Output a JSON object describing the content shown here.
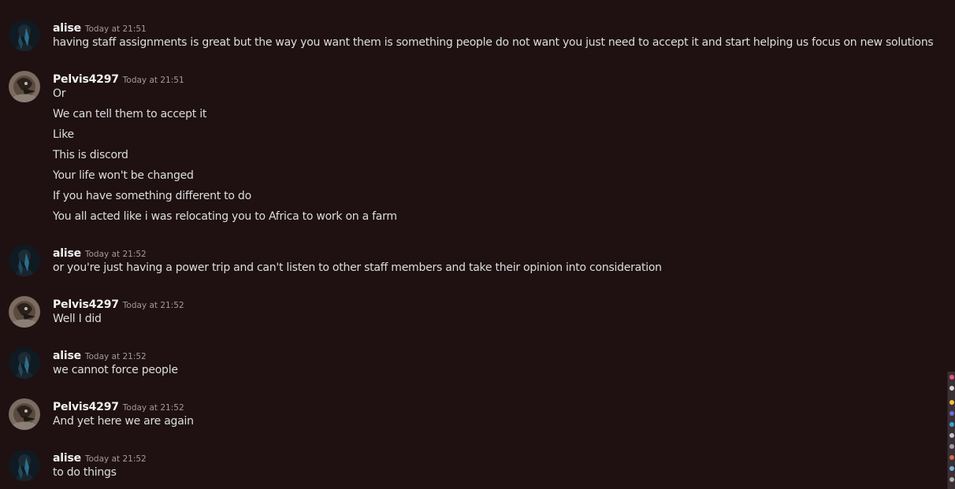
{
  "colors": {
    "background": "#1f1111",
    "username": "#f2f3f5",
    "timestamp": "#a39a9a",
    "message": "#dbdee1"
  },
  "messages": [
    {
      "author": "alise",
      "avatar": "alise-avatar-icon",
      "time": "Today at 21:51",
      "lines": [
        "having staff assignments is great but the way you want them is something people do not want you just need to accept it and start helping us focus on new solutions"
      ]
    },
    {
      "author": "Pelvis4297",
      "avatar": "pelvis-avatar-icon",
      "time": "Today at 21:51",
      "lines": [
        "Or",
        "We can tell them to accept it",
        "Like",
        "This is discord",
        "Your life won't be changed",
        "If you have something different to do",
        "You all acted like i was relocating you to Africa to work on a farm"
      ]
    },
    {
      "author": "alise",
      "avatar": "alise-avatar-icon",
      "time": "Today at 21:52",
      "lines": [
        "or you're just having a power trip and can't listen to other staff members and take their opinion into consideration"
      ]
    },
    {
      "author": "Pelvis4297",
      "avatar": "pelvis-avatar-icon",
      "time": "Today at 21:52",
      "lines": [
        "Well I did"
      ]
    },
    {
      "author": "alise",
      "avatar": "alise-avatar-icon",
      "time": "Today at 21:52",
      "lines": [
        "we cannot force people"
      ]
    },
    {
      "author": "Pelvis4297",
      "avatar": "pelvis-avatar-icon",
      "time": "Today at 21:52",
      "lines": [
        "And yet here we are again"
      ]
    },
    {
      "author": "alise",
      "avatar": "alise-avatar-icon",
      "time": "Today at 21:52",
      "lines": [
        "to do things"
      ]
    }
  ]
}
